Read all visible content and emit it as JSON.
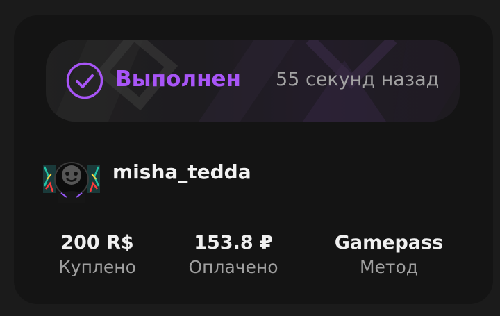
{
  "order": {
    "status": "Выполнен",
    "time": "55 секунд назад",
    "username": "misha_tedda",
    "stats": [
      {
        "value": "200 R$",
        "label": "Куплено"
      },
      {
        "value": "153.8 ₽",
        "label": "Оплачено"
      },
      {
        "value": "Gamepass",
        "label": "Метод"
      }
    ]
  },
  "colors": {
    "accent": "#a855f7",
    "background": "#141414",
    "text": "#f0f0f0",
    "muted": "#a0a0a0"
  },
  "icons": {
    "status": "check-circle-icon",
    "avatar": "user-avatar"
  }
}
